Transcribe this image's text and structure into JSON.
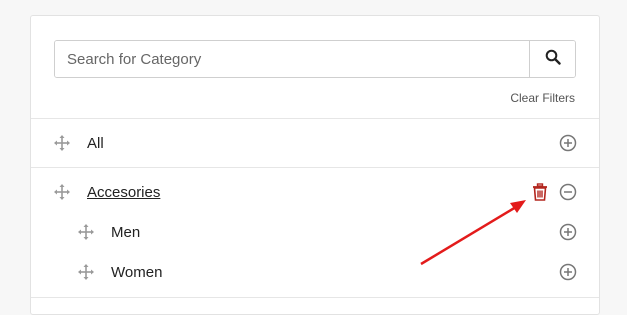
{
  "search": {
    "placeholder": "Search for Category",
    "button_icon": "search-icon"
  },
  "filters": {
    "clear_label": "Clear Filters"
  },
  "categories": [
    {
      "label": "All",
      "action_icon": "plus-circle-icon",
      "expanded": false
    },
    {
      "label": "Accesories",
      "action_icon": "minus-circle-icon",
      "extra_icon": "trash-icon",
      "expanded": true,
      "children": [
        {
          "label": "Men",
          "action_icon": "plus-circle-icon"
        },
        {
          "label": "Women",
          "action_icon": "plus-circle-icon"
        }
      ]
    }
  ],
  "colors": {
    "trash": "#b3261e",
    "arrow": "#e31b1b",
    "icon_gray": "#8a8a8a"
  }
}
